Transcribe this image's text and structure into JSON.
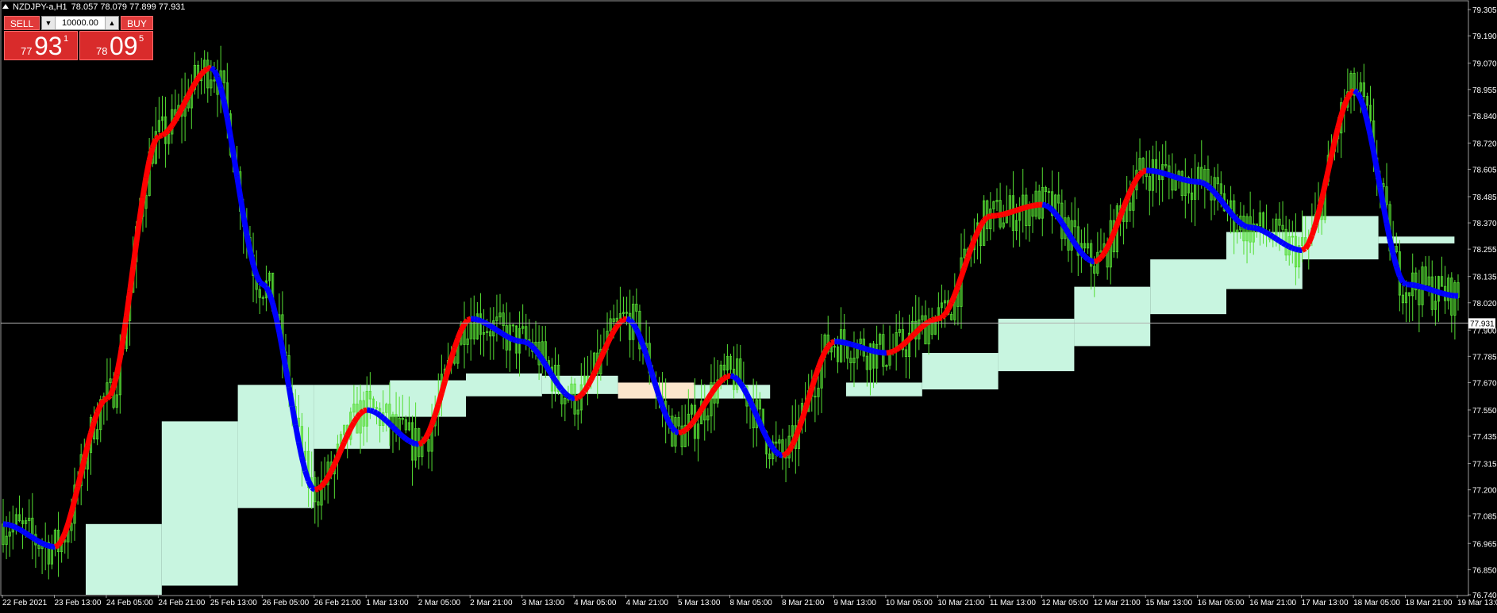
{
  "header": {
    "symbol": "NZDJPY-a,H1",
    "ohlc": "78.057 78.079 77.899 77.931"
  },
  "trade_panel": {
    "sell_label": "SELL",
    "buy_label": "BUY",
    "lot_value": "10000.00",
    "sell_price": {
      "prefix": "77",
      "big": "93",
      "sup": "1"
    },
    "buy_price": {
      "prefix": "78",
      "big": "09",
      "sup": "5"
    }
  },
  "colors": {
    "background": "#000000",
    "candle": "#55dd33",
    "heiken_up": "#ff0000",
    "heiken_down": "#0000ff",
    "zone_fill": "#c8f5e0",
    "zone_alt": "#fbe6cc",
    "axis_text": "#ffffff",
    "price_line": "#b0b0b0"
  },
  "chart_data": {
    "type": "line",
    "ylim": [
      76.74,
      79.34
    ],
    "y_ticks": [
      "79.305",
      "79.190",
      "79.070",
      "78.955",
      "78.840",
      "78.720",
      "78.605",
      "78.485",
      "78.370",
      "78.255",
      "78.135",
      "78.020",
      "77.900",
      "77.785",
      "77.670",
      "77.550",
      "77.435",
      "77.315",
      "77.200",
      "77.085",
      "76.965",
      "76.850",
      "76.740"
    ],
    "x_ticks": [
      "22 Feb 2021",
      "23 Feb 13:00",
      "24 Feb 05:00",
      "24 Feb 21:00",
      "25 Feb 13:00",
      "26 Feb 05:00",
      "26 Feb 21:00",
      "1 Mar 13:00",
      "2 Mar 05:00",
      "2 Mar 21:00",
      "3 Mar 13:00",
      "4 Mar 05:00",
      "4 Mar 21:00",
      "5 Mar 13:00",
      "8 Mar 05:00",
      "8 Mar 21:00",
      "9 Mar 13:00",
      "10 Mar 05:00",
      "10 Mar 21:00",
      "11 Mar 13:00",
      "12 Mar 05:00",
      "12 Mar 21:00",
      "15 Mar 13:00",
      "16 Mar 05:00",
      "16 Mar 21:00",
      "17 Mar 13:00",
      "18 Mar 05:00",
      "18 Mar 21:00",
      "19 Mar 13:00"
    ],
    "current_price": "77.931",
    "current_price_value": 77.931,
    "series": [
      {
        "x": [
          "22 Feb 2021",
          "23 Feb 13:00",
          "24 Feb 05:00",
          "24 Feb 21:00",
          "25 Feb 13:00",
          "26 Feb 05:00",
          "26 Feb 21:00",
          "1 Mar 13:00",
          "2 Mar 05:00",
          "2 Mar 21:00",
          "3 Mar 13:00",
          "4 Mar 05:00",
          "4 Mar 21:00",
          "5 Mar 13:00",
          "8 Mar 05:00",
          "8 Mar 21:00",
          "9 Mar 13:00",
          "10 Mar 05:00",
          "10 Mar 21:00",
          "11 Mar 13:00",
          "12 Mar 05:00",
          "12 Mar 21:00",
          "15 Mar 13:00",
          "16 Mar 05:00",
          "16 Mar 21:00",
          "17 Mar 13:00",
          "18 Mar 05:00",
          "18 Mar 21:00",
          "19 Mar 13:00"
        ],
        "values": [
          77.05,
          76.95,
          77.6,
          78.75,
          79.05,
          78.1,
          77.2,
          77.55,
          77.4,
          77.95,
          77.85,
          77.6,
          77.95,
          77.45,
          77.7,
          77.35,
          77.85,
          77.8,
          77.95,
          78.4,
          78.45,
          78.2,
          78.6,
          78.55,
          78.35,
          78.25,
          78.95,
          78.1,
          78.05
        ]
      }
    ],
    "zones": [
      {
        "from": 1.0,
        "to": 2.0,
        "low": 76.74,
        "high": 77.05
      },
      {
        "from": 2.0,
        "to": 3.0,
        "low": 76.78,
        "high": 77.5
      },
      {
        "from": 3.0,
        "to": 4.0,
        "low": 77.12,
        "high": 77.66
      },
      {
        "from": 4.0,
        "to": 5.0,
        "low": 77.38,
        "high": 77.66
      },
      {
        "from": 5.0,
        "to": 6.0,
        "low": 77.52,
        "high": 77.68
      },
      {
        "from": 6.0,
        "to": 7.0,
        "low": 77.61,
        "high": 77.71
      },
      {
        "from": 7.0,
        "to": 8.0,
        "low": 77.62,
        "high": 77.7
      },
      {
        "from": 8.0,
        "to": 9.0,
        "low": 77.6,
        "high": 77.67,
        "alt": true
      },
      {
        "from": 9.0,
        "to": 10.0,
        "low": 77.6,
        "high": 77.66
      },
      {
        "from": 11.0,
        "to": 12.0,
        "low": 77.61,
        "high": 77.67
      },
      {
        "from": 12.0,
        "to": 13.0,
        "low": 77.64,
        "high": 77.8
      },
      {
        "from": 13.0,
        "to": 14.0,
        "low": 77.72,
        "high": 77.95
      },
      {
        "from": 14.0,
        "to": 15.0,
        "low": 77.83,
        "high": 78.09
      },
      {
        "from": 15.0,
        "to": 16.0,
        "low": 77.97,
        "high": 78.21
      },
      {
        "from": 16.0,
        "to": 17.0,
        "low": 78.08,
        "high": 78.33
      },
      {
        "from": 17.0,
        "to": 18.0,
        "low": 78.21,
        "high": 78.4
      },
      {
        "from": 18.0,
        "to": 19.0,
        "low": 78.28,
        "high": 78.31
      }
    ]
  }
}
